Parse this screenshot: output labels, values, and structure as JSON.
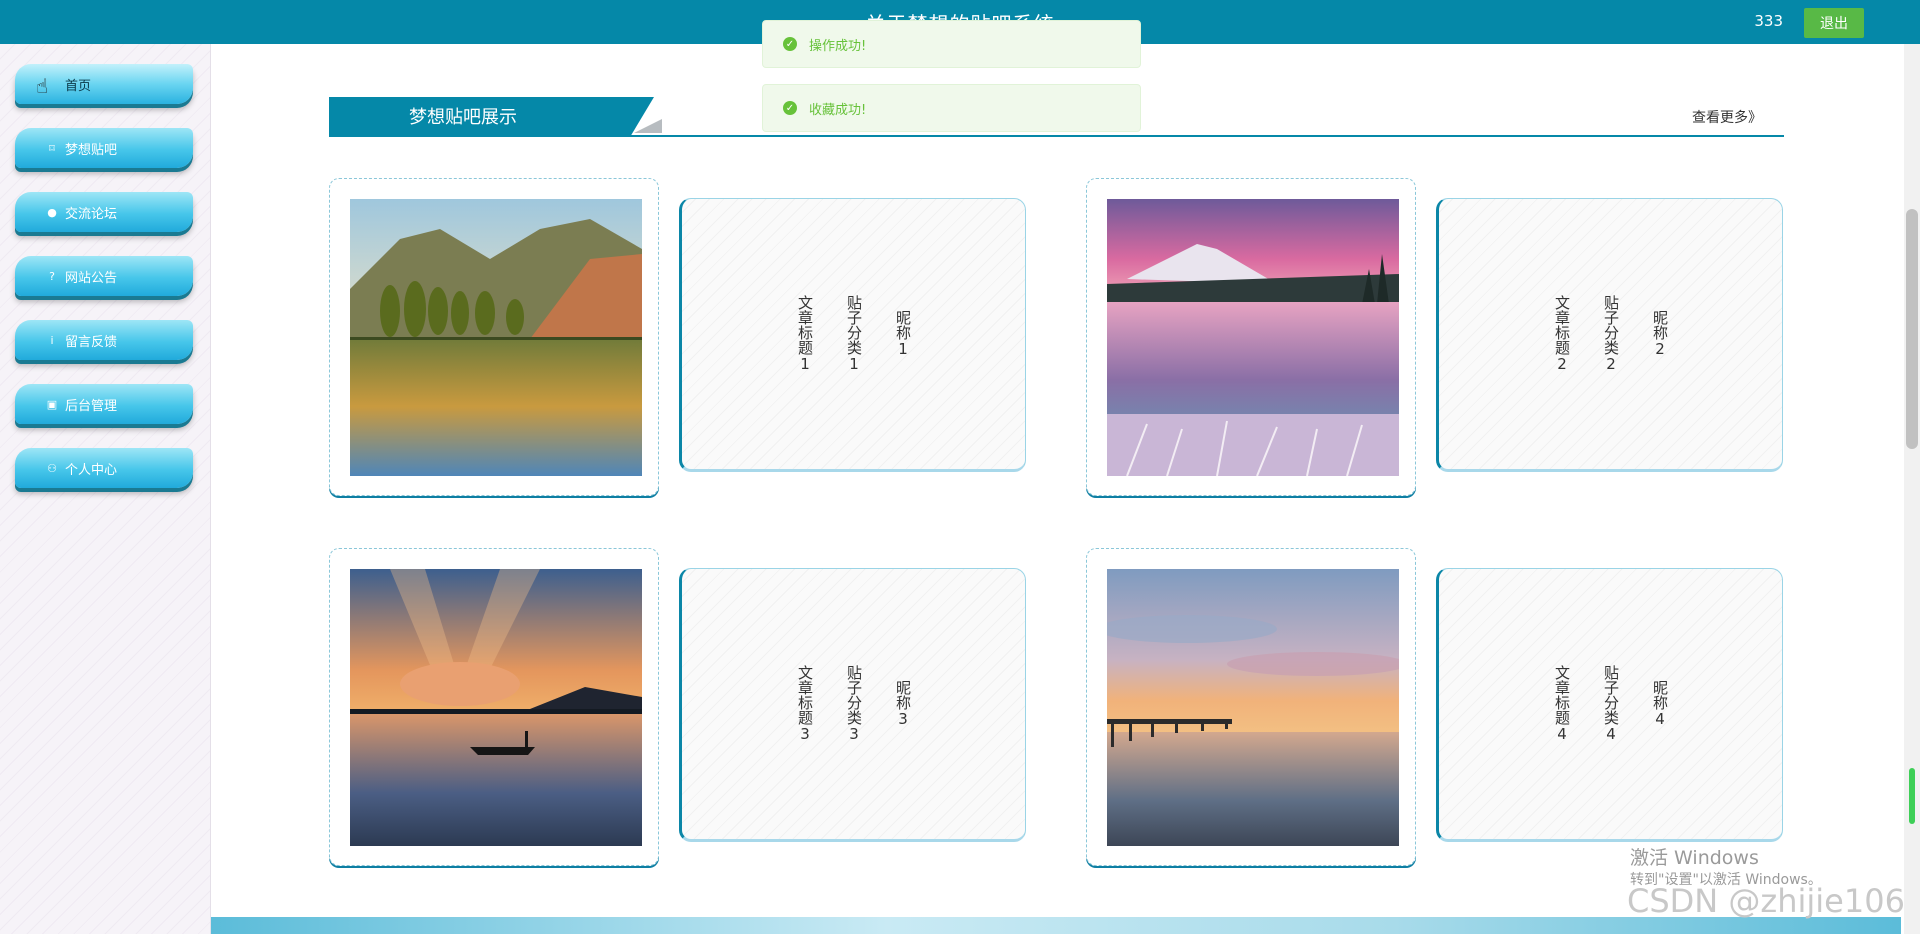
{
  "header": {
    "title": "关于梦想的贴吧系统",
    "username": "333",
    "logout_label": "退出"
  },
  "sidebar": {
    "items": [
      {
        "label": "首页",
        "icon": "home-icon",
        "glyph": "⌂"
      },
      {
        "label": "梦想贴吧",
        "icon": "bag-icon",
        "glyph": "⌑"
      },
      {
        "label": "交流论坛",
        "icon": "info-circle-icon",
        "glyph": "●"
      },
      {
        "label": "网站公告",
        "icon": "question-circle-icon",
        "glyph": "?"
      },
      {
        "label": "留言反馈",
        "icon": "info-circle-icon",
        "glyph": "i"
      },
      {
        "label": "后台管理",
        "icon": "admin-icon",
        "glyph": "▣"
      },
      {
        "label": "个人中心",
        "icon": "user-icon",
        "glyph": "⚇"
      }
    ]
  },
  "toasts": [
    {
      "message": "操作成功!"
    },
    {
      "message": "收藏成功!"
    }
  ],
  "section": {
    "title": "梦想贴吧展示",
    "more_label": "查看更多》"
  },
  "cards": [
    {
      "title": "文章标题1",
      "category": "贴子分类1",
      "nickname": "昵称1"
    },
    {
      "title": "文章标题2",
      "category": "贴子分类2",
      "nickname": "昵称2"
    },
    {
      "title": "文章标题3",
      "category": "贴子分类3",
      "nickname": "昵称3"
    },
    {
      "title": "文章标题4",
      "category": "贴子分类4",
      "nickname": "昵称4"
    }
  ],
  "watermark": {
    "line1": "激活 Windows",
    "line2": "转到\"设置\"以激活 Windows。",
    "csdn": "CSDN @zhijie106"
  },
  "colors": {
    "primary": "#0588a8",
    "success": "#67c23a",
    "logout": "#58b946"
  }
}
